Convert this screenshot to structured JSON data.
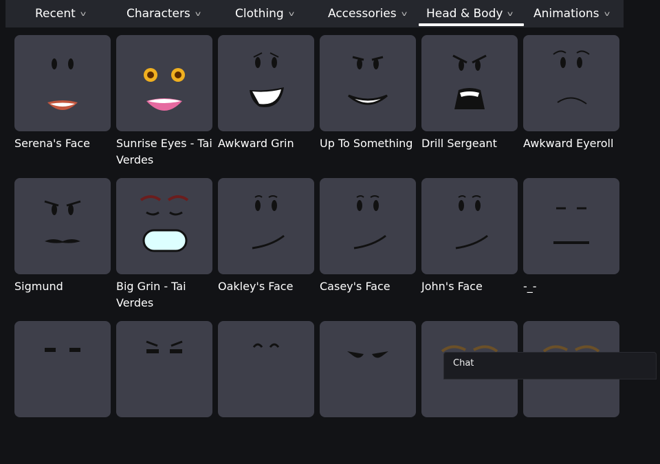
{
  "nav": {
    "tabs": [
      {
        "label": "Recent",
        "active": false
      },
      {
        "label": "Characters",
        "active": false
      },
      {
        "label": "Clothing",
        "active": false
      },
      {
        "label": "Accessories",
        "active": false
      },
      {
        "label": "Head & Body",
        "active": true
      },
      {
        "label": "Animations",
        "active": false
      }
    ]
  },
  "items": [
    {
      "name": "Serena's Face",
      "face": "smile-lips"
    },
    {
      "name": "Sunrise Eyes - Tai Verdes",
      "face": "sunrise"
    },
    {
      "name": "Awkward Grin",
      "face": "awkward-grin"
    },
    {
      "name": "Up To Something",
      "face": "up-to-something"
    },
    {
      "name": "Drill Sergeant",
      "face": "drill"
    },
    {
      "name": "Awkward Eyeroll",
      "face": "eyeroll"
    },
    {
      "name": "Sigmund",
      "face": "sigmund"
    },
    {
      "name": "Big Grin - Tai Verdes",
      "face": "big-grin"
    },
    {
      "name": "Oakley's Face",
      "face": "smirk"
    },
    {
      "name": "Casey's Face",
      "face": "smirk"
    },
    {
      "name": "John's Face",
      "face": "smirk"
    },
    {
      "name": "-_-",
      "face": "flat"
    },
    {
      "name": "",
      "face": "squint"
    },
    {
      "name": "",
      "face": "squint-brows"
    },
    {
      "name": "",
      "face": "happy-closed"
    },
    {
      "name": "",
      "face": "angry-low"
    },
    {
      "name": "",
      "face": "brows"
    },
    {
      "name": "",
      "face": "brows"
    }
  ],
  "chat": {
    "label": "Chat"
  }
}
